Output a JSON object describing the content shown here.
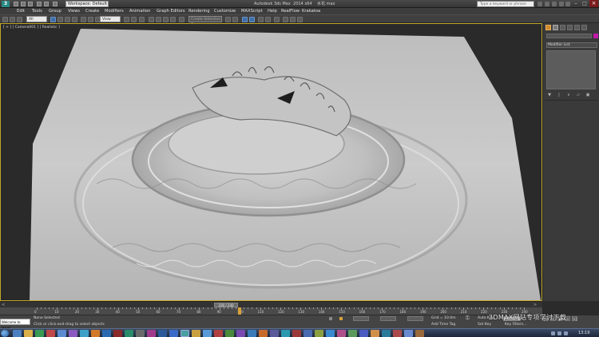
{
  "titlebar": {
    "app_icon": "3ds-max-logo-icon",
    "workspace": "Workspace: Default",
    "title": "Autodesk 3ds Max  2014 x64    水花.max",
    "search_placeholder": "Type a keyword or phrase"
  },
  "menu": [
    "Edit",
    "Tools",
    "Group",
    "Views",
    "Create",
    "Modifiers",
    "Animation",
    "Graph Editors",
    "Rendering",
    "Customize",
    "MAXScript",
    "Help",
    "RealFlow",
    "Krakatoa"
  ],
  "toolbar": {
    "filter_value": "All",
    "coord_value": "View",
    "selection_set_placeholder": "Create Selection Se"
  },
  "viewport": {
    "label": "[ + ] [ Camera001 ] [ Realistic ]"
  },
  "command_panel": {
    "modifier_list_label": "Modifier List",
    "stack_icons": [
      "pin-icon",
      "show-end-result-icon",
      "make-unique-icon",
      "remove-modifier-icon",
      "configure-sets-icon"
    ]
  },
  "timeline": {
    "frame_display": "100 / 240",
    "current_frame": 100,
    "total_frames": 240,
    "ticks": [
      "0",
      "10",
      "20",
      "30",
      "40",
      "50",
      "60",
      "70",
      "80",
      "90",
      "100",
      "110",
      "120",
      "130",
      "140",
      "150",
      "160",
      "170",
      "180",
      "190",
      "200",
      "210",
      "220",
      "230",
      "240"
    ]
  },
  "statusbar": {
    "maxscript": "Welcome to MAXS",
    "selection": "None Selected",
    "prompt": "Click or click-and-drag to select objects",
    "grid": "Grid = 10.0m",
    "add_time_tag": "Add Time Tag",
    "auto_key": "Auto Key",
    "set_key": "Set Key",
    "selected_dropdown": "Selected",
    "key_filters": "Key Filters..."
  },
  "watermark": "3DMAX网站专项学讨下载",
  "taskbar": {
    "clock": "13:19"
  }
}
